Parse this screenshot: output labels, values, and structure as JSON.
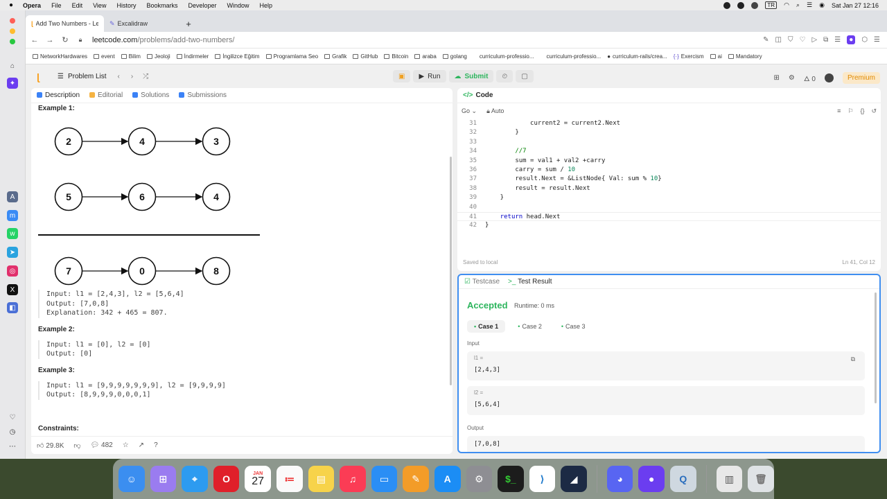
{
  "menubar": {
    "apple": "",
    "items": [
      "Opera",
      "File",
      "Edit",
      "View",
      "History",
      "Bookmarks",
      "Developer",
      "Window",
      "Help"
    ],
    "input_source": "TR",
    "datetime": "Sat Jan 27  12:16"
  },
  "browser": {
    "tabs": [
      {
        "title": "Add Two Numbers - Lee"
      },
      {
        "title": "Excalidraw"
      }
    ],
    "new_tab": "+",
    "url_host": "leetcode.com",
    "url_path": "/problems/add-two-numbers/",
    "bookmarks": [
      "NetworkHardwares",
      "event",
      "Bilim",
      "Jeoloji",
      "İndirmeler",
      "İngilizce Eğitim",
      "Programlama Seo",
      "Grafik",
      "GitHub",
      "Bitcoin",
      "araba",
      "golang",
      "curriculum-professio...",
      "curriculum-professio...",
      "curriculum-rails/crea...",
      "Exercism",
      "ai",
      "Mandatory"
    ]
  },
  "app": {
    "problem_list": "Problem List",
    "run": "Run",
    "submit": "Submit",
    "coin_count": "0",
    "premium": "Premium"
  },
  "left_panel": {
    "tabs": [
      "Description",
      "Editorial",
      "Solutions",
      "Submissions"
    ],
    "example1": {
      "title": "Example 1:",
      "list1": [
        "2",
        "4",
        "3"
      ],
      "list2": [
        "5",
        "6",
        "4"
      ],
      "result": [
        "7",
        "0",
        "8"
      ],
      "input": "Input: l1 = [2,4,3], l2 = [5,6,4]",
      "output": "Output: [7,0,8]",
      "explanation": "Explanation: 342 + 465 = 807."
    },
    "example2": {
      "title": "Example 2:",
      "input": "Input: l1 = [0], l2 = [0]",
      "output": "Output: [0]"
    },
    "example3": {
      "title": "Example 3:",
      "input": "Input: l1 = [9,9,9,9,9,9,9], l2 = [9,9,9,9]",
      "output": "Output: [8,9,9,9,0,0,0,1]"
    },
    "constraints": "Constraints:",
    "likes": "29.8K",
    "comments": "482"
  },
  "code_panel": {
    "title": "Code",
    "language": "Go",
    "mode": "Auto",
    "lines": [
      {
        "n": "31",
        "t": "            current2 = current2.Next"
      },
      {
        "n": "32",
        "t": "        }"
      },
      {
        "n": "33",
        "t": ""
      },
      {
        "n": "34",
        "t": "        //7"
      },
      {
        "n": "35",
        "t": "        sum = val1 + val2 +carry"
      },
      {
        "n": "36",
        "t": "        carry = sum / 10"
      },
      {
        "n": "37",
        "t": "        result.Next = &ListNode{ Val: sum % 10}"
      },
      {
        "n": "38",
        "t": "        result = result.Next"
      },
      {
        "n": "39",
        "t": "    }"
      },
      {
        "n": "40",
        "t": ""
      },
      {
        "n": "41",
        "t": "    return head.Next"
      },
      {
        "n": "42",
        "t": "}"
      }
    ],
    "saved": "Saved to local",
    "cursor": "Ln 41, Col 12"
  },
  "result_panel": {
    "tabs": [
      "Testcase",
      "Test Result"
    ],
    "status": "Accepted",
    "runtime": "Runtime: 0 ms",
    "cases": [
      "Case 1",
      "Case 2",
      "Case 3"
    ],
    "input_label": "Input",
    "l1_label": "l1 =",
    "l1_value": "[2,4,3]",
    "l2_label": "l2 =",
    "l2_value": "[5,6,4]",
    "output_label": "Output",
    "output_value": "[7,0,8]"
  },
  "dock": {
    "calendar_month": "JAN",
    "calendar_day": "27"
  }
}
